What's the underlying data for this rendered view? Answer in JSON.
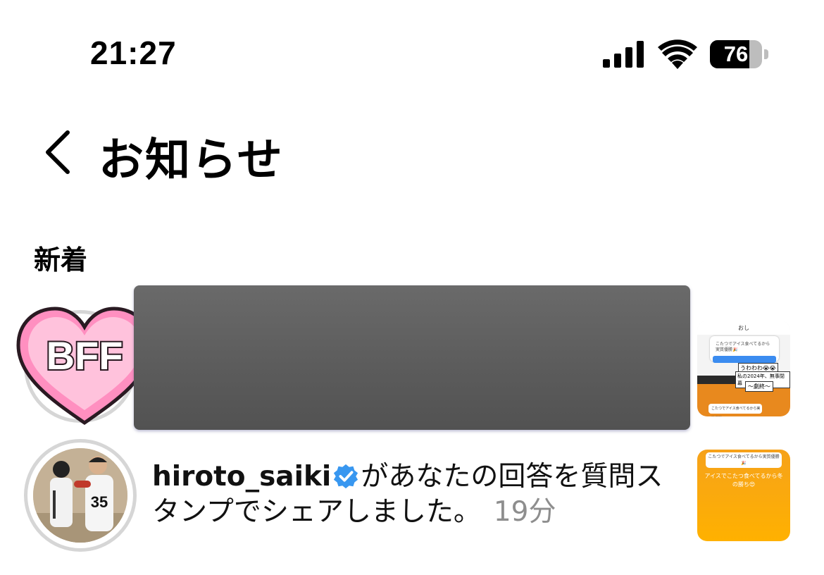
{
  "status_bar": {
    "time": "21:27",
    "battery_level": "76",
    "battery_fraction": 0.76
  },
  "header": {
    "back_icon": "chevron-left-icon",
    "title": "お知らせ"
  },
  "section_title": "新着",
  "notifications": [
    {
      "avatar_badge_text": "BFF",
      "avatar_icon": "bff-heart-icon",
      "content_redacted": true,
      "thumbnail": {
        "header": "おし",
        "card_text": "こたつでアイス食べてるから実質優勝🎉",
        "stamp1": "うわわわ😭😭",
        "stamp2": "私の2024年、無事閉幕",
        "stamp3": "〜劇終〜",
        "bubble": "こたつでアイス食べてるから実質優勝"
      }
    },
    {
      "username": "hiroto_saiki",
      "verified_icon": "verified-badge-icon",
      "message": "があなたの回答を質問スタンプでシェアしました。",
      "time": "19分",
      "thumbnail": {
        "card_text": "こたつでアイス食べてるから実質優勝🎉",
        "text": "アイスでこたつ食べてるから冬の勝ち😍"
      }
    }
  ],
  "colors": {
    "verified_blue": "#3897f0",
    "time_gray": "#8e8e8e",
    "redaction_gray": "#5e5e5e",
    "thumb_orange": "#ffb100"
  }
}
